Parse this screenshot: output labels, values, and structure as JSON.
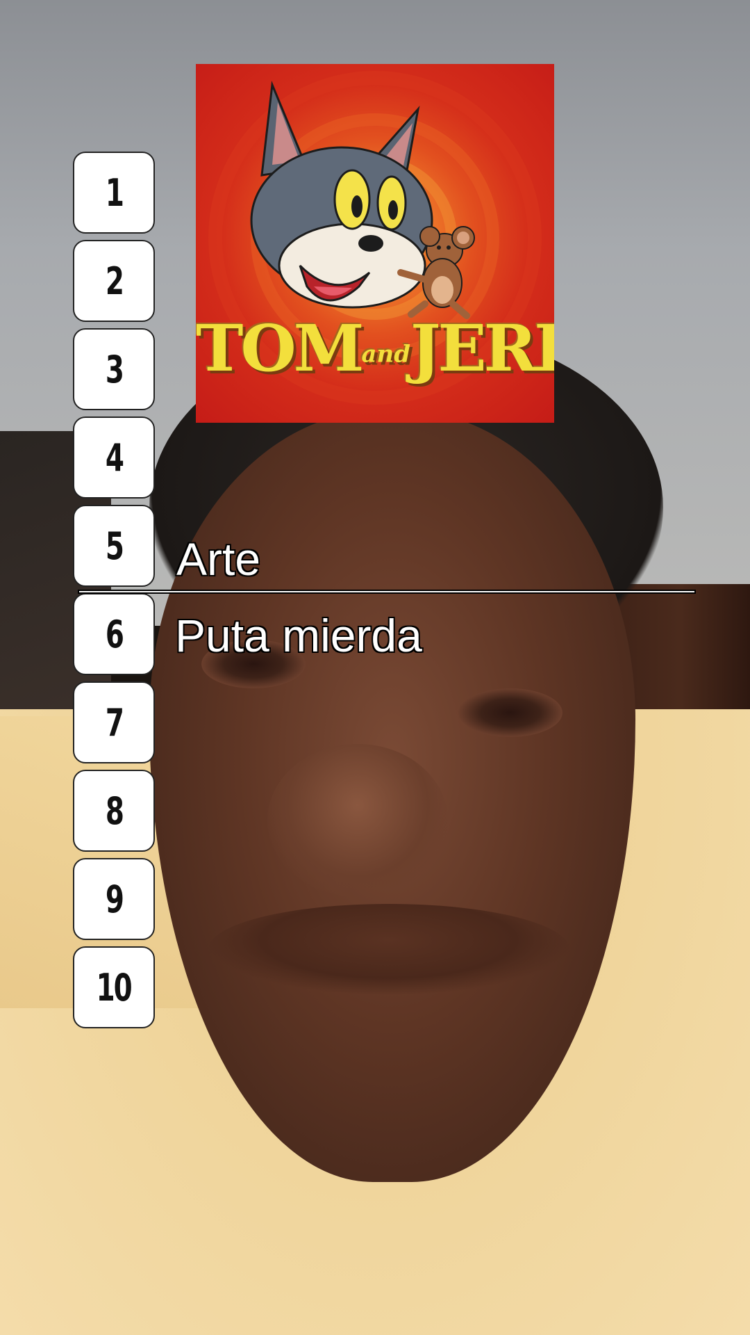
{
  "tier_scale": [
    "1",
    "2",
    "3",
    "4",
    "5",
    "6",
    "7",
    "8",
    "9",
    "10"
  ],
  "cover": {
    "title_left": "TOM",
    "title_and": "and",
    "title_right": "JERRY"
  },
  "labels": {
    "upper": "Arte",
    "lower": "Puta mierda"
  },
  "colors": {
    "cover_background": "#d42d1a",
    "cover_title": "#f3df3c",
    "label_text": "#ffffff",
    "tier_box": "#ffffff"
  }
}
